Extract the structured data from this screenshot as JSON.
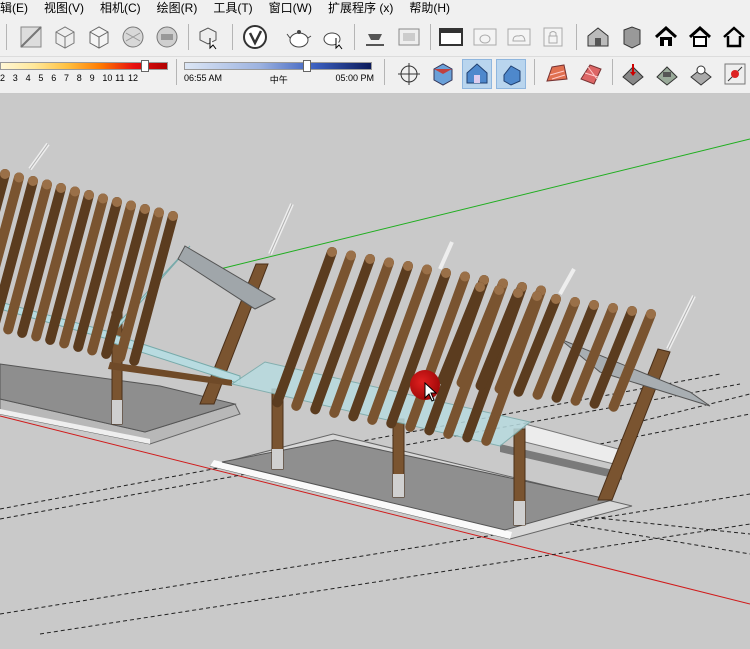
{
  "menu": {
    "items": [
      "辑(E)",
      "视图(V)",
      "相机(C)",
      "绘图(R)",
      "工具(T)",
      "窗口(W)",
      "扩展程序 (x)",
      "帮助(H)"
    ]
  },
  "toolbar": {
    "icons": [
      "xray-face-icon",
      "wireframe-cube-icon",
      "hidden-line-cube-icon",
      "shaded-cube-icon",
      "textured-cube-icon",
      "monochrome-cube-icon",
      "component-edit-icon",
      "vray-logo-icon",
      "teapot-render-icon",
      "teapot-interactive-icon",
      "render-settings-icon",
      "frame-buffer-icon",
      "window-icon",
      "teapot-window-icon",
      "cloud-window-icon",
      "lock-window-icon",
      "warehouse-icon",
      "component-icon",
      "home-icon",
      "home-outline-icon",
      "home-line-icon"
    ]
  },
  "shadow": {
    "ticks": [
      "2",
      "3",
      "4",
      "5",
      "6",
      "7",
      "8",
      "9",
      "10",
      "11",
      "12"
    ],
    "date_level": 0.88
  },
  "time": {
    "start": "06:55 AM",
    "mid": "中午",
    "end": "05:00 PM",
    "level": 0.66
  },
  "toolbar2": {
    "icons": [
      "axes-icon",
      "iso-view-icon",
      "house-view-front-icon",
      "house-view-top-icon",
      "terrain-icon",
      "sandbox-grid-icon",
      "drape-icon",
      "stamp-icon",
      "flip-icon",
      "add-detail-icon"
    ]
  },
  "colors": {
    "viewport_bg": "#c9c9c9",
    "wood": "#7a5430",
    "wood_dark": "#5b3c1f",
    "glass": "#b8dbe0",
    "axis_red": "#d01a1a",
    "axis_green": "#1fae1f"
  }
}
